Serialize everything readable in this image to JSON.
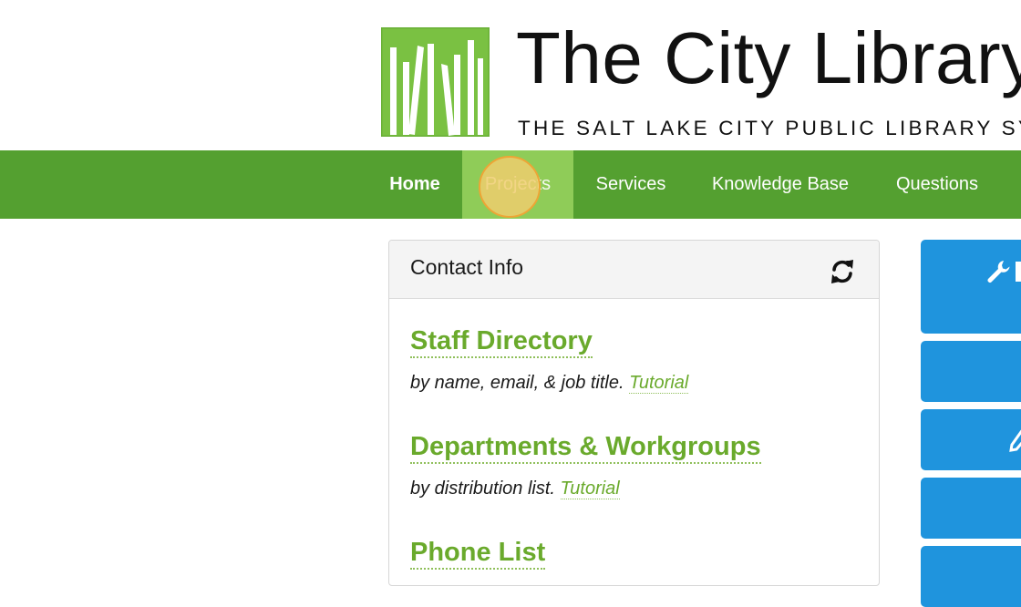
{
  "logo": {
    "title": "The City Library",
    "tagline": "THE SALT LAKE CITY PUBLIC LIBRARY SYSTEM",
    "mark_color": "#7ac142"
  },
  "nav": {
    "items": [
      {
        "label": "Home"
      },
      {
        "label": "Projects"
      },
      {
        "label": "Services"
      },
      {
        "label": "Knowledge Base"
      },
      {
        "label": "Questions"
      }
    ],
    "active": "Projects",
    "bar_color": "#54a030",
    "active_color": "#8fcc58"
  },
  "panel": {
    "title": "Contact Info",
    "entries": [
      {
        "title": "Staff Directory",
        "desc": "by name, email, & job title.",
        "link": "Tutorial"
      },
      {
        "title": "Departments & Workgroups",
        "desc": "by distribution list.",
        "link": "Tutorial"
      },
      {
        "title": "Phone List"
      }
    ],
    "link_color": "#6aaa2c"
  },
  "side_buttons": {
    "color": "#1f94dd",
    "icons": [
      "wrench-icon",
      "",
      "pencil-icon",
      "",
      ""
    ]
  }
}
